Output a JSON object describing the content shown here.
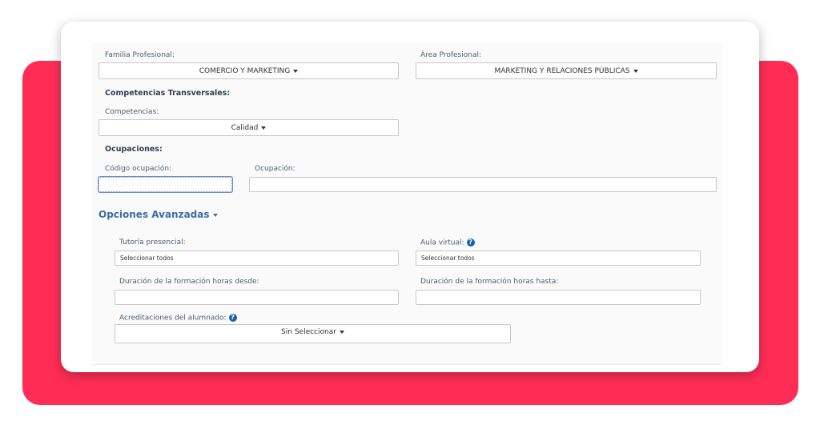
{
  "familia": {
    "label": "Familia Profesional:",
    "value": "COMERCIO Y MARKETING"
  },
  "area": {
    "label": "Área Profesional:",
    "value": "MARKETING Y RELACIONES PÚBLICAS"
  },
  "competencias_transversales": {
    "heading": "Competencias Transversales:",
    "label": "Competencias:",
    "value": "Calidad"
  },
  "ocupaciones": {
    "heading": "Ocupaciones:",
    "codigo_label": "Código ocupación:",
    "codigo_value": "",
    "ocupacion_label": "Ocupación:",
    "ocupacion_value": ""
  },
  "avanzadas": {
    "toggle_label": "Opciones Avanzadas",
    "tutoria": {
      "label": "Tutoría presencial:",
      "value": "Seleccionar todos"
    },
    "aula": {
      "label": "Aula virtual:",
      "value": "Seleccionar todos"
    },
    "duracion_desde": {
      "label": "Duración de la formación horas desde:",
      "value": ""
    },
    "duracion_hasta": {
      "label": "Duración de la formación horas hasta:",
      "value": ""
    },
    "acreditaciones": {
      "label": "Acreditaciones del alumnado:",
      "value": "Sin Seleccionar"
    }
  },
  "icons": {
    "help": "question-circle-icon",
    "dropdown": "caret-down-icon"
  },
  "colors": {
    "accent_red": "#ff2d55",
    "link_blue": "#3a6fa5",
    "help_blue": "#1b5fb0"
  }
}
